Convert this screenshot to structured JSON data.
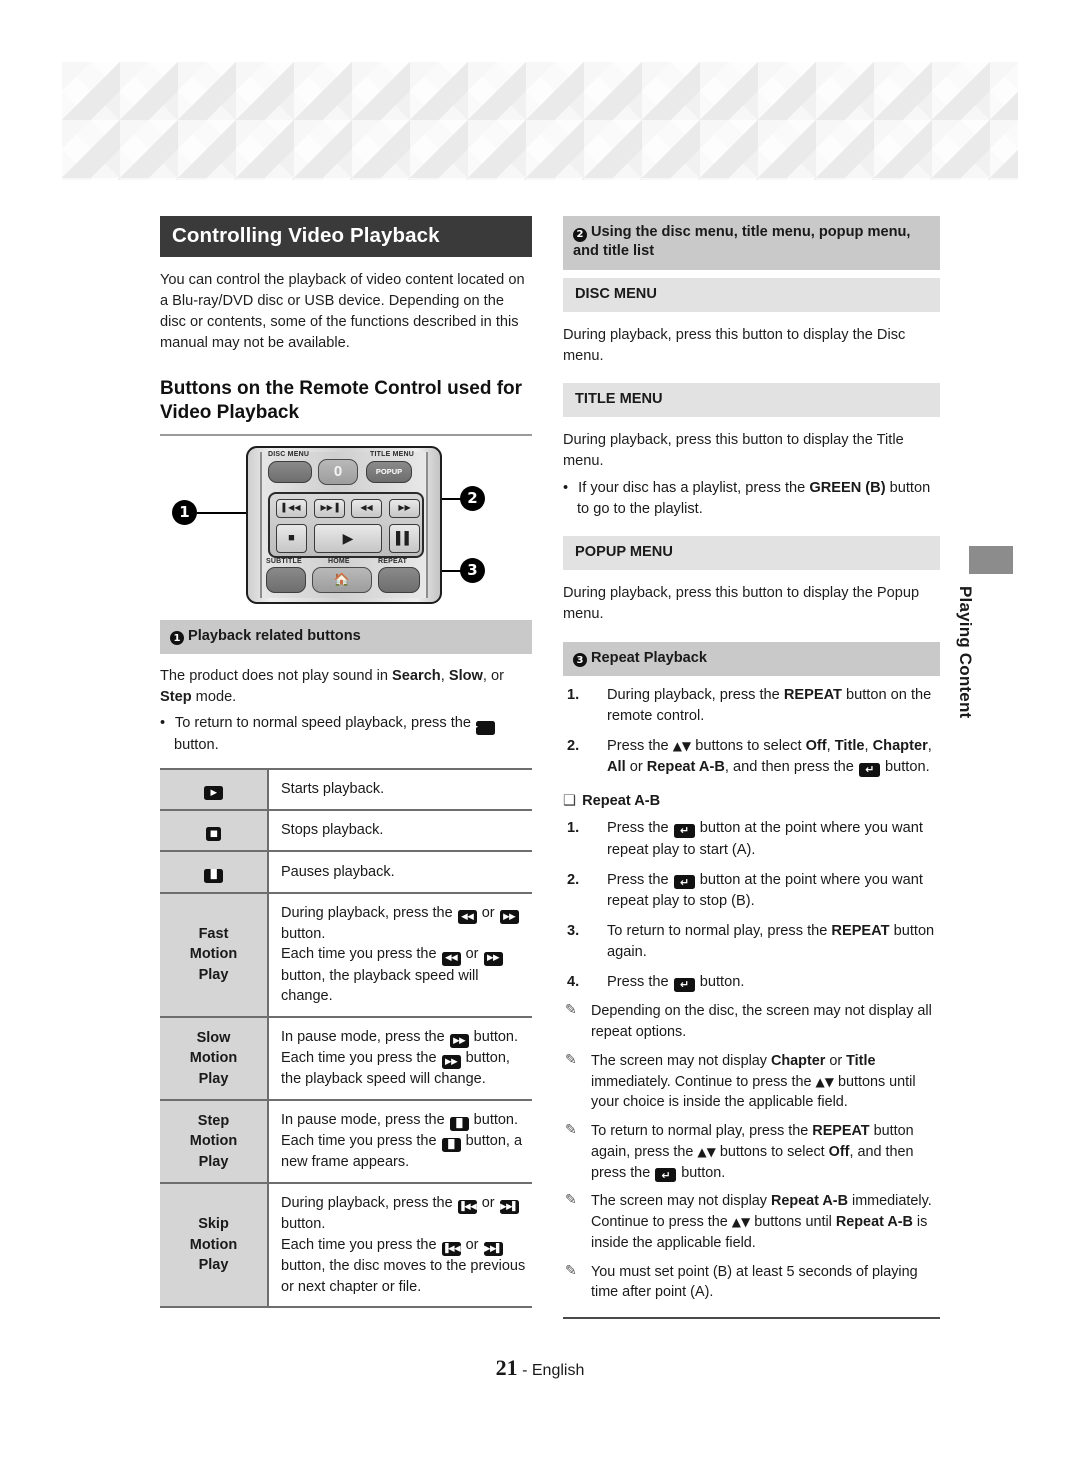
{
  "page": {
    "number": "21",
    "footer_suffix": "- English",
    "side_tab_label": "Playing Content"
  },
  "left": {
    "title": "Controlling Video Playback",
    "intro": "You can control the playback of video content located on a Blu-ray/DVD disc or USB device. Depending on the disc or contents, some of the functions described in this manual may not be available.",
    "subheading": "Buttons on the Remote Control used for Video Playback",
    "remote": {
      "labels": {
        "disc_menu": "DISC MENU",
        "title_menu": "TITLE MENU",
        "popup": "POPUP",
        "zero": "0",
        "subtitle": "SUBTITLE",
        "home": "HOME",
        "repeat": "REPEAT"
      },
      "transport_keys": [
        "prev-track",
        "next-track",
        "rewind",
        "fast-forward",
        "stop",
        "play",
        "pause"
      ],
      "markers": [
        "1",
        "2",
        "3"
      ]
    },
    "section1": {
      "badge": "1",
      "heading": "Playback related buttons",
      "paragraph_pre": "The product does not play sound in ",
      "paragraph_b1": "Search",
      "paragraph_mid": ", ",
      "paragraph_b2": "Slow",
      "paragraph_mid2": ", or ",
      "paragraph_b3": "Step",
      "paragraph_post": " mode.",
      "bullet_pre": "To return to normal speed playback, press the ",
      "bullet_post": " button."
    },
    "table_rows": [
      {
        "key_type": "glyph",
        "key": "play",
        "value_parts": [
          {
            "t": "text",
            "v": "Starts playback."
          }
        ]
      },
      {
        "key_type": "glyph",
        "key": "stop",
        "value_parts": [
          {
            "t": "text",
            "v": "Stops playback."
          }
        ]
      },
      {
        "key_type": "glyph",
        "key": "pause",
        "value_parts": [
          {
            "t": "text",
            "v": "Pauses playback."
          }
        ]
      },
      {
        "key_type": "label",
        "key": "Fast\nMotion\nPlay",
        "value_parts": [
          {
            "t": "text",
            "v": "During playback, press the "
          },
          {
            "t": "glyph",
            "v": "rewind"
          },
          {
            "t": "text",
            "v": " or "
          },
          {
            "t": "glyph",
            "v": "ffwd"
          },
          {
            "t": "text",
            "v": " button."
          },
          {
            "t": "br"
          },
          {
            "t": "text",
            "v": "Each time you press the "
          },
          {
            "t": "glyph",
            "v": "rewind"
          },
          {
            "t": "text",
            "v": " or "
          },
          {
            "t": "glyph",
            "v": "ffwd"
          },
          {
            "t": "text",
            "v": " button, the playback speed will change."
          }
        ]
      },
      {
        "key_type": "label",
        "key": "Slow\nMotion\nPlay",
        "value_parts": [
          {
            "t": "text",
            "v": "In pause mode, press the "
          },
          {
            "t": "glyph",
            "v": "ffwd"
          },
          {
            "t": "text",
            "v": " button."
          },
          {
            "t": "br"
          },
          {
            "t": "text",
            "v": "Each time you press the "
          },
          {
            "t": "glyph",
            "v": "ffwd"
          },
          {
            "t": "text",
            "v": " button, the playback speed will change."
          }
        ]
      },
      {
        "key_type": "label",
        "key": "Step\nMotion\nPlay",
        "value_parts": [
          {
            "t": "text",
            "v": "In pause mode, press the "
          },
          {
            "t": "glyph",
            "v": "pause"
          },
          {
            "t": "text",
            "v": " button."
          },
          {
            "t": "br"
          },
          {
            "t": "text",
            "v": "Each time you press the "
          },
          {
            "t": "glyph",
            "v": "pause"
          },
          {
            "t": "text",
            "v": " button, a new frame appears."
          }
        ]
      },
      {
        "key_type": "label",
        "key": "Skip\nMotion\nPlay",
        "value_parts": [
          {
            "t": "text",
            "v": "During playback, press the "
          },
          {
            "t": "glyph",
            "v": "prev"
          },
          {
            "t": "text",
            "v": " or "
          },
          {
            "t": "glyph",
            "v": "next"
          },
          {
            "t": "text",
            "v": " button."
          },
          {
            "t": "br"
          },
          {
            "t": "text",
            "v": "Each time you press the "
          },
          {
            "t": "glyph",
            "v": "prev"
          },
          {
            "t": "text",
            "v": " or "
          },
          {
            "t": "glyph",
            "v": "next"
          },
          {
            "t": "text",
            "v": " button, the disc moves to the previous or next chapter or file."
          }
        ]
      }
    ]
  },
  "right": {
    "section2": {
      "badge": "2",
      "heading": "Using the disc menu, title menu, popup menu, and title list"
    },
    "disc_menu": {
      "heading": "DISC MENU",
      "text": "During playback, press this button to display the Disc menu."
    },
    "title_menu": {
      "heading": "TITLE MENU",
      "text": "During playback, press this button to display the Title menu.",
      "bullet_pre": "If your disc has a playlist, press the ",
      "bullet_bold": "GREEN (B)",
      "bullet_post": " button to go to the playlist."
    },
    "popup_menu": {
      "heading": "POPUP MENU",
      "text": "During playback, press this button to display the Popup menu."
    },
    "section3": {
      "badge": "3",
      "heading": "Repeat Playback",
      "steps": [
        {
          "n": "1.",
          "parts": [
            {
              "t": "text",
              "v": "During playback, press the "
            },
            {
              "t": "b",
              "v": "REPEAT"
            },
            {
              "t": "text",
              "v": " button on the remote control."
            }
          ]
        },
        {
          "n": "2.",
          "parts": [
            {
              "t": "text",
              "v": "Press the "
            },
            {
              "t": "arrows",
              "v": "▲▼"
            },
            {
              "t": "text",
              "v": " buttons to select "
            },
            {
              "t": "b",
              "v": "Off"
            },
            {
              "t": "text",
              "v": ", "
            },
            {
              "t": "b",
              "v": "Title"
            },
            {
              "t": "text",
              "v": ", "
            },
            {
              "t": "b",
              "v": "Chapter"
            },
            {
              "t": "text",
              "v": ", "
            },
            {
              "t": "b",
              "v": "All"
            },
            {
              "t": "text",
              "v": " or "
            },
            {
              "t": "b",
              "v": "Repeat A-B"
            },
            {
              "t": "text",
              "v": ", and then press the "
            },
            {
              "t": "glyph",
              "v": "enter"
            },
            {
              "t": "text",
              "v": " button."
            }
          ]
        }
      ]
    },
    "repeat_ab": {
      "heading": "Repeat A-B",
      "steps": [
        {
          "n": "1.",
          "parts": [
            {
              "t": "text",
              "v": "Press the "
            },
            {
              "t": "glyph",
              "v": "enter"
            },
            {
              "t": "text",
              "v": " button at the point where you want repeat play to start (A)."
            }
          ]
        },
        {
          "n": "2.",
          "parts": [
            {
              "t": "text",
              "v": "Press the "
            },
            {
              "t": "glyph",
              "v": "enter"
            },
            {
              "t": "text",
              "v": " button at the point where you want repeat play to stop (B)."
            }
          ]
        },
        {
          "n": "3.",
          "parts": [
            {
              "t": "text",
              "v": "To return to normal play, press the "
            },
            {
              "t": "b",
              "v": "REPEAT"
            },
            {
              "t": "text",
              "v": " button again."
            }
          ]
        },
        {
          "n": "4.",
          "parts": [
            {
              "t": "text",
              "v": "Press the "
            },
            {
              "t": "glyph",
              "v": "enter"
            },
            {
              "t": "text",
              "v": " button."
            }
          ]
        }
      ]
    },
    "notes": [
      [
        {
          "t": "text",
          "v": "Depending on the disc, the screen may not display all repeat options."
        }
      ],
      [
        {
          "t": "text",
          "v": "The screen may not display "
        },
        {
          "t": "b",
          "v": "Chapter"
        },
        {
          "t": "text",
          "v": " or "
        },
        {
          "t": "b",
          "v": "Title"
        },
        {
          "t": "text",
          "v": " immediately. Continue to press the "
        },
        {
          "t": "arrows",
          "v": "▲▼"
        },
        {
          "t": "text",
          "v": " buttons until your choice is inside the applicable field."
        }
      ],
      [
        {
          "t": "text",
          "v": "To return to normal play, press the "
        },
        {
          "t": "b",
          "v": "REPEAT"
        },
        {
          "t": "text",
          "v": " button again, press the "
        },
        {
          "t": "arrows",
          "v": "▲▼"
        },
        {
          "t": "text",
          "v": " buttons to select "
        },
        {
          "t": "b",
          "v": "Off"
        },
        {
          "t": "text",
          "v": ", and then press the "
        },
        {
          "t": "glyph",
          "v": "enter"
        },
        {
          "t": "text",
          "v": " button."
        }
      ],
      [
        {
          "t": "text",
          "v": "The screen may not display "
        },
        {
          "t": "b",
          "v": "Repeat A-B"
        },
        {
          "t": "text",
          "v": " immediately. Continue to press the "
        },
        {
          "t": "arrows",
          "v": "▲▼"
        },
        {
          "t": "text",
          "v": " buttons until "
        },
        {
          "t": "b",
          "v": "Repeat A-B"
        },
        {
          "t": "text",
          "v": " is inside the applicable field."
        }
      ],
      [
        {
          "t": "text",
          "v": "You must set point (B) at least 5 seconds of playing time after point (A)."
        }
      ]
    ]
  },
  "glyphs": {
    "play": "▶",
    "stop": "■",
    "pause": "▐▌",
    "rewind": "◀◀",
    "ffwd": "▶▶",
    "prev": "▐◀◀",
    "next": "▶▶▌",
    "enter": "↵"
  },
  "colors": {
    "title_bar_bg": "#3a3a3a",
    "caption_bar_bg": "#c9c9c9",
    "caption_bar_light_bg": "#e2e2e2",
    "table_key_bg": "#d5d5d5",
    "side_tab_bg": "#8c8c8c"
  }
}
